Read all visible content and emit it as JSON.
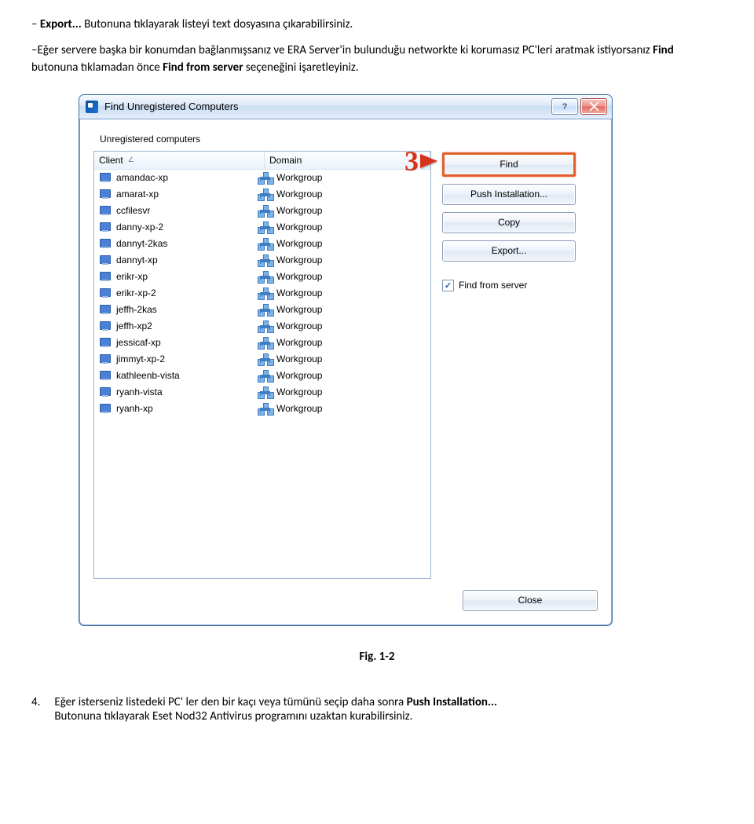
{
  "doc": {
    "line1_prefix": "– ",
    "line1_bold": "Export...",
    "line1_rest": " Butonuna tıklayarak listeyi text dosyasına çıkarabilirsiniz.",
    "line2_part1": "–Eğer servere başka bir konumdan bağlanmışsanız ve ERA Server'in bulunduğu networkte ki korumasız PC'leri aratmak istiyorsanız ",
    "line2_b1": "Find",
    "line2_mid": " butonuna tıklamadan önce ",
    "line2_b2": "Find from server",
    "line2_end": " seçeneğini işaretleyiniz.",
    "fig_label": "Fig. 1-2",
    "step4_num": "4.",
    "step4_l1a": "Eğer isterseniz listedeki PC' ler den bir kaçı veya tümünü seçip daha sonra ",
    "step4_l1b": "Push Installation...",
    "step4_l2": "Butonuna tıklayarak Eset Nod32 Antivirus programını uzaktan kurabilirsiniz."
  },
  "dialog": {
    "title": "Find Unregistered Computers",
    "group_label": "Unregistered computers",
    "col_client": "Client",
    "col_domain": "Domain",
    "callout_num": "3",
    "buttons": {
      "find": "Find",
      "push": "Push Installation...",
      "copy": "Copy",
      "export": "Export...",
      "close": "Close"
    },
    "checkbox_label": "Find from server",
    "rows": [
      {
        "client": "amandac-xp",
        "domain": "Workgroup"
      },
      {
        "client": "amarat-xp",
        "domain": "Workgroup"
      },
      {
        "client": "ccfilesvr",
        "domain": "Workgroup"
      },
      {
        "client": "danny-xp-2",
        "domain": "Workgroup"
      },
      {
        "client": "dannyt-2kas",
        "domain": "Workgroup"
      },
      {
        "client": "dannyt-xp",
        "domain": "Workgroup"
      },
      {
        "client": "erikr-xp",
        "domain": "Workgroup"
      },
      {
        "client": "erikr-xp-2",
        "domain": "Workgroup"
      },
      {
        "client": "jeffh-2kas",
        "domain": "Workgroup"
      },
      {
        "client": "jeffh-xp2",
        "domain": "Workgroup"
      },
      {
        "client": "jessicaf-xp",
        "domain": "Workgroup"
      },
      {
        "client": "jimmyt-xp-2",
        "domain": "Workgroup"
      },
      {
        "client": "kathleenb-vista",
        "domain": "Workgroup"
      },
      {
        "client": "ryanh-vista",
        "domain": "Workgroup"
      },
      {
        "client": "ryanh-xp",
        "domain": "Workgroup"
      }
    ]
  }
}
